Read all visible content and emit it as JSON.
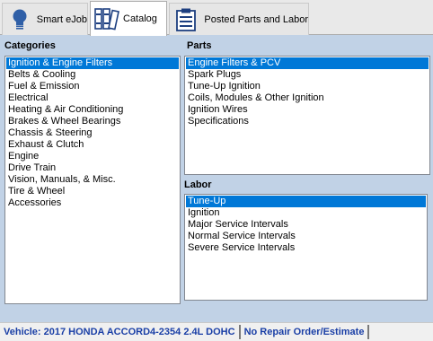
{
  "tabs": [
    {
      "label": "Smart eJob",
      "icon": "lightbulb-icon",
      "active": false
    },
    {
      "label": "Catalog",
      "icon": "catalog-books-icon",
      "active": true
    },
    {
      "label": "Posted Parts and Labor",
      "icon": "clipboard-list-icon",
      "active": false
    }
  ],
  "categories": {
    "title": "Categories",
    "items": [
      "Ignition & Engine Filters",
      "Belts & Cooling",
      "Fuel & Emission",
      "Electrical",
      "Heating & Air Conditioning",
      "Brakes & Wheel Bearings",
      "Chassis & Steering",
      "Exhaust & Clutch",
      "Engine",
      "Drive Train",
      "Vision, Manuals, & Misc.",
      "Tire & Wheel",
      "Accessories"
    ],
    "selected_index": 0
  },
  "parts": {
    "title": "Parts",
    "items": [
      "Engine Filters & PCV",
      "Spark Plugs",
      "Tune-Up Ignition",
      "Coils, Modules & Other Ignition",
      "Ignition Wires",
      "Specifications"
    ],
    "selected_index": 0
  },
  "labor": {
    "title": "Labor",
    "items": [
      "Tune-Up",
      "Ignition",
      "Major Service Intervals",
      "Normal Service Intervals",
      "Severe Service Intervals"
    ],
    "selected_index": 0
  },
  "status": {
    "vehicle": "Vehicle: 2017 HONDA ACCORD4-2354 2.4L DOHC",
    "repair_order": "No Repair Order/Estimate"
  },
  "colors": {
    "selection": "#0078d7",
    "panel_background": "#c1d2e6",
    "status_text": "#1a3fa6"
  }
}
